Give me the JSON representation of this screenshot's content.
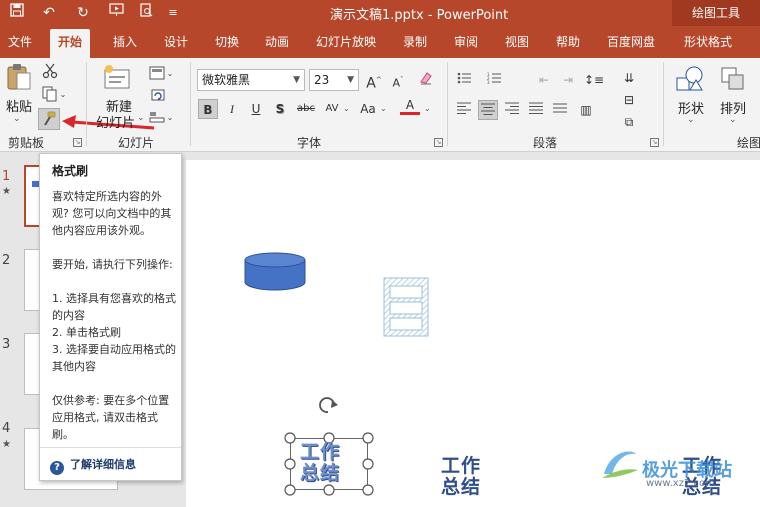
{
  "titlebar": {
    "title": "演示文稿1.pptx  -  PowerPoint",
    "context_tab": "绘图工具",
    "qa_icons": [
      "save-icon",
      "undo-icon",
      "redo-icon",
      "from-beginning-icon",
      "print-preview-icon",
      "customize-icon"
    ]
  },
  "tabs": [
    "文件",
    "开始",
    "插入",
    "设计",
    "切换",
    "动画",
    "幻灯片放映",
    "录制",
    "审阅",
    "视图",
    "帮助",
    "百度网盘",
    "形状格式"
  ],
  "ribbon": {
    "clipboard": {
      "paste": "粘贴",
      "group": "剪贴板"
    },
    "slides": {
      "new_slide": "新建",
      "new_slide2": "幻灯片",
      "group": "幻灯片"
    },
    "font": {
      "name": "微软雅黑",
      "size": "23",
      "group": "字体",
      "buttons": [
        "B",
        "I",
        "U",
        "S",
        "abc",
        "AV",
        "Aa",
        "A"
      ]
    },
    "paragraph": {
      "group": "段落"
    },
    "drawing": {
      "shapes": "形状",
      "arrange": "排列",
      "group": "绘图"
    }
  },
  "thumbs": {
    "numbers": [
      "1",
      "2",
      "3",
      "4"
    ],
    "star": "★"
  },
  "tooltip": {
    "title": "格式刷",
    "p1": "喜欢特定所选内容的外观? 您可以向文档中的其他内容应用该外观。",
    "p2": "要开始, 请执行下列操作:",
    "step1": "1. 选择具有您喜欢的格式的内容",
    "step2": "2. 单击格式刷",
    "step3": "3. 选择要自动应用格式的其他内容",
    "p3": "仅供参考: 要在多个位置应用格式, 请双击格式刷。",
    "learn_more": "了解详细信息"
  },
  "slide": {
    "wordart_line1": "工作",
    "wordart_line2": "总结",
    "wordart2_line1": "工作",
    "wordart2_line2": "总结",
    "wordart3_line1": "工作",
    "wordart3_line2": "总结"
  },
  "watermark": {
    "text": "极光下载站",
    "url": "www.xz7.com"
  },
  "colors": {
    "accent": "#b7472a",
    "shape_blue": "#4472c4",
    "wordart": "#2f4d8a",
    "arrow": "#d9262b"
  }
}
